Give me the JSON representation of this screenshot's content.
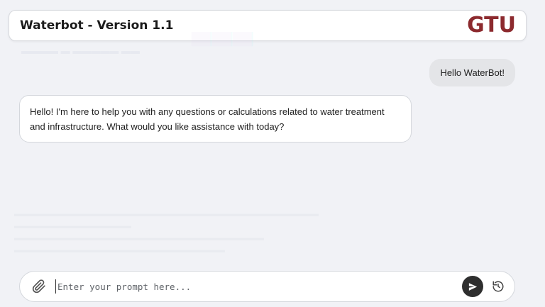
{
  "header": {
    "title": "Waterbot - Version 1.1",
    "logo_text": "GTU"
  },
  "messages": [
    {
      "role": "user",
      "text": "Hello WaterBot!"
    },
    {
      "role": "assistant",
      "text": "Hello! I'm here to help you with any questions or calculations related to water treatment and infrastructure. What would you like assistance with today?"
    }
  ],
  "composer": {
    "placeholder": "Enter your prompt here...",
    "value": ""
  },
  "icons": {
    "attach": "paperclip-icon",
    "send": "send-icon",
    "reset": "refresh-icon"
  },
  "colors": {
    "background": "#f1f2f6",
    "logo": "#8c2a2e",
    "user_bubble": "#e4e5e8",
    "send_button": "#2e2e2e"
  }
}
